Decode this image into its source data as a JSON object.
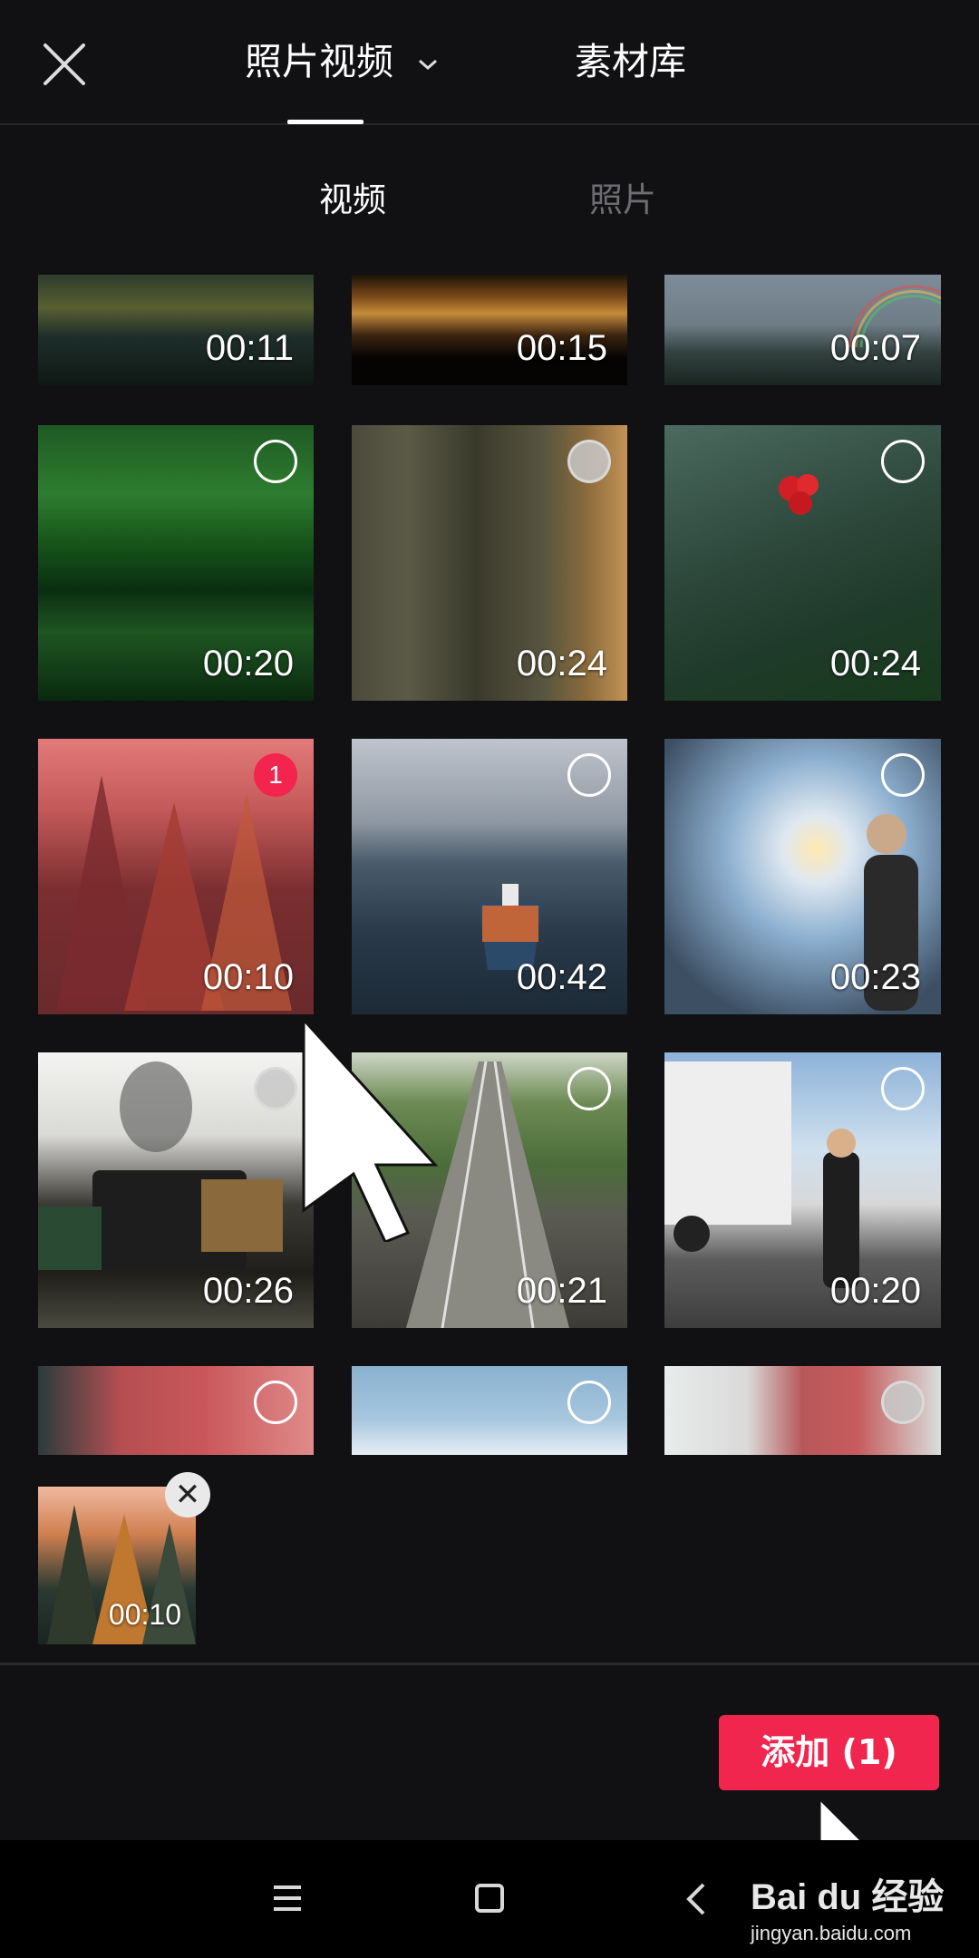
{
  "header": {
    "tab_photos_videos": "照片视频",
    "tab_library": "素材库"
  },
  "subtabs": {
    "video": "视频",
    "photo": "照片"
  },
  "grid": [
    {
      "duration": "00:11",
      "scene": "lake"
    },
    {
      "duration": "00:15",
      "scene": "sunset-water"
    },
    {
      "duration": "00:07",
      "scene": "mountains-rainbow"
    },
    {
      "duration": "00:20",
      "scene": "green-forest-reflection",
      "selection": "empty"
    },
    {
      "duration": "00:24",
      "scene": "wooden-post",
      "selection": "disabled"
    },
    {
      "duration": "00:24",
      "scene": "branch-red-flower",
      "selection": "empty"
    },
    {
      "duration": "00:10",
      "scene": "pink-forest",
      "selection": "1"
    },
    {
      "duration": "00:42",
      "scene": "container-ship",
      "selection": "empty"
    },
    {
      "duration": "00:23",
      "scene": "tunnel-person",
      "selection": "empty"
    },
    {
      "duration": "00:26",
      "scene": "steam-train",
      "selection": "disabled"
    },
    {
      "duration": "00:21",
      "scene": "railway-tracks",
      "selection": "empty"
    },
    {
      "duration": "00:20",
      "scene": "truck-worker",
      "selection": "empty"
    },
    {
      "duration": "",
      "scene": "containers",
      "selection": "empty"
    },
    {
      "duration": "",
      "scene": "sky",
      "selection": "empty"
    },
    {
      "duration": "",
      "scene": "crane",
      "selection": "disabled"
    }
  ],
  "selected_tray": {
    "items": [
      {
        "duration": "00:10",
        "scene": "pink-forest"
      }
    ],
    "remove_symbol": "✕"
  },
  "add_button": {
    "label": "添加 (1)",
    "color": "#f0264f"
  },
  "watermark": {
    "logo": "Bai du 经验",
    "url": "jingyan.baidu.com"
  },
  "icons": [
    "close-icon",
    "chevron-down-icon",
    "menu-icon",
    "home-icon",
    "back-icon",
    "cursor-icon"
  ]
}
